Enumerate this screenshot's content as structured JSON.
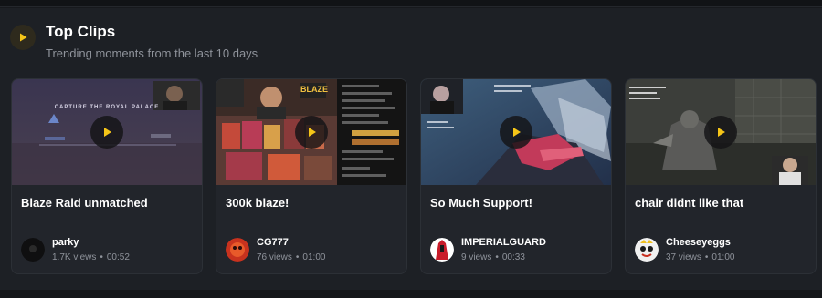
{
  "header": {
    "title": "Top Clips",
    "subtitle": "Trending moments from the last 10 days",
    "icon": "play-icon",
    "accent": "#f5c518"
  },
  "clips": [
    {
      "title": "Blaze Raid unmatched",
      "author": "parky",
      "views": "1.7K views",
      "duration": "00:52",
      "thumb_text": "CAPTURE THE ROYAL PALACE"
    },
    {
      "title": "300k blaze!",
      "author": "CG777",
      "views": "76 views",
      "duration": "01:00",
      "thumb_text": "BLAZE"
    },
    {
      "title": "So Much Support!",
      "author": "IMPERIALGUARD",
      "views": "9 views",
      "duration": "00:33"
    },
    {
      "title": "chair didnt like that",
      "author": "Cheeseyeggs",
      "views": "37 views",
      "duration": "01:00"
    }
  ],
  "separator": "•"
}
